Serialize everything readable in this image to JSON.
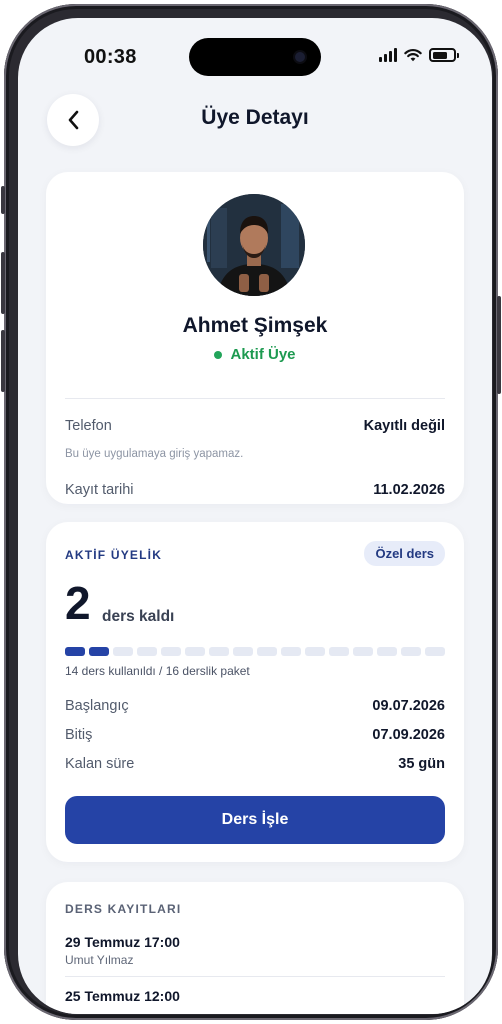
{
  "status_bar": {
    "time": "00:38"
  },
  "header": {
    "title": "Üye Detayı"
  },
  "profile": {
    "name": "Ahmet Şimşek",
    "status": "Aktif Üye",
    "status_color": "#22a45a",
    "phone_label": "Telefon",
    "phone_value": "Kayıtlı değil",
    "note": "Bu üye uygulamaya giriş yapamaz.",
    "registered_label": "Kayıt tarihi",
    "registered_value": "11.02.2026"
  },
  "membership": {
    "section_title": "AKTİF ÜYELİK",
    "badge": "Özel ders",
    "remaining": "2",
    "remaining_label": "ders kaldı",
    "progress": {
      "used_segments": 2,
      "total_segments": 16
    },
    "usage_text": "14 ders kullanıldı / 16 derslik paket",
    "start_label": "Başlangıç",
    "start_value": "09.07.2026",
    "end_label": "Bitiş",
    "end_value": "07.09.2026",
    "remaining_time_label": "Kalan süre",
    "remaining_time_value": "35 gün",
    "action_label": "Ders İşle",
    "accent_color": "#2543a6"
  },
  "lessons": {
    "section_title": "DERS KAYITLARI",
    "items": [
      {
        "datetime": "29 Temmuz 17:00",
        "trainer": "Umut Yılmaz"
      },
      {
        "datetime": "25 Temmuz 12:00"
      }
    ]
  }
}
